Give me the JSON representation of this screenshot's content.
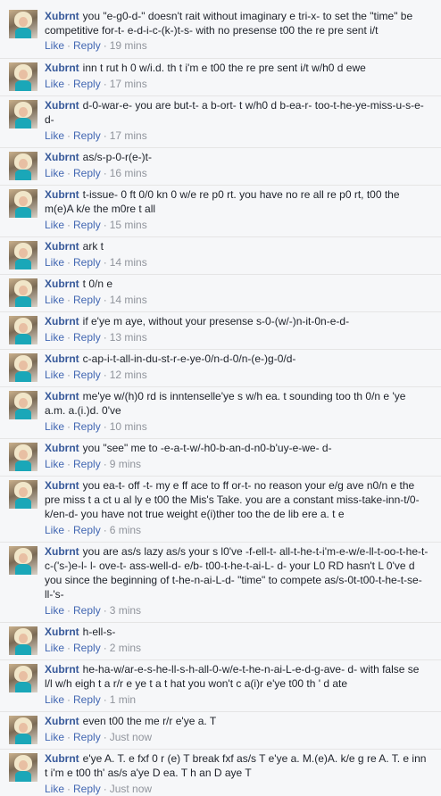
{
  "labels": {
    "like": "Like",
    "reply": "Reply",
    "sep": "·"
  },
  "comments": [
    {
      "author": "Xubrnt",
      "text": "you \"e-g0-d-\" doesn't rait without imaginary e tri-x- to set the \"time\" be competitive for-t- e-d-i-c-(k-)t-s- with no presense t00 the re pre sent i/t",
      "time": "19 mins"
    },
    {
      "author": "Xubrnt",
      "text": "inn t rut h 0 w/i.d. th t i'm e t00 the re pre sent i/t w/h0 d ewe",
      "time": "17 mins"
    },
    {
      "author": "Xubrnt",
      "text": "d-0-war-e- you are but-t- a b-ort- t w/h0 d b-ea-r- too-t-he-ye-miss-u-s-e-d-",
      "time": "17 mins"
    },
    {
      "author": "Xubrnt",
      "text": "as/s-p-0-r(e-)t-",
      "time": "16 mins"
    },
    {
      "author": "Xubrnt",
      "text": "t-issue- 0 ft 0/0 kn 0 w/e re p0 rt. you have no re all re p0 rt, t00 the m(e)A k/e the m0re t all",
      "time": "15 mins"
    },
    {
      "author": "Xubrnt",
      "text": "ark t",
      "time": "14 mins"
    },
    {
      "author": "Xubrnt",
      "text": "t 0/n e",
      "time": "14 mins"
    },
    {
      "author": "Xubrnt",
      "text": "if e'ye m aye, without your presense s-0-(w/-)n-it-0n-e-d-",
      "time": "13 mins"
    },
    {
      "author": "Xubrnt",
      "text": "c-ap-i-t-all-in-du-st-r-e-ye-0/n-d-0/n-(e-)g-0/d-",
      "time": "12 mins"
    },
    {
      "author": "Xubrnt",
      "text": "me'ye w/(h)0 rd is inntenselle'ye s w/h ea. t sounding too th 0/n e 'ye a.m. a.(i.)d. 0've",
      "time": "10 mins"
    },
    {
      "author": "Xubrnt",
      "text": "you \"see\" me to -e-a-t-w/-h0-b-an-d-n0-b'uy-e-we- d-",
      "time": "9 mins"
    },
    {
      "author": "Xubrnt",
      "text": "you ea-t- off -t- my e ff ace to ff or-t- no reason your e/g ave n0/n e the pre miss t a ct u al ly e t00 the Mis's Take. you are a constant miss-take-inn-t/0-k/en-d- you have not true weight e(i)ther too the de lib ere a. t e",
      "time": "6 mins"
    },
    {
      "author": "Xubrnt",
      "text": "you are as/s lazy as/s your s l0've -f-ell-t- all-t-he-t-i'm-e-w/e-ll-t-oo-t-he-t-c-('s-)e-l- l- ove-t- ass-well-d- e/b- t00-t-he-t-ai-L- d- your L0 RD hasn't L 0've d you since the beginning of t-he-n-ai-L-d- \"time\" to compete as/s-0t-t00-t-he-t-se-ll-'s-",
      "time": "3 mins"
    },
    {
      "author": "Xubrnt",
      "text": "h-ell-s-",
      "time": "2 mins"
    },
    {
      "author": "Xubrnt",
      "text": "he-ha-w/ar-e-s-he-ll-s-h-all-0-w/e-t-he-n-ai-L-e-d-g-ave- d- with false se l/l w/h eigh t a r/r e ye t a t hat you won't c a(i)r e'ye t00 th ' d ate",
      "time": "1 min"
    },
    {
      "author": "Xubrnt",
      "text": "even t00 the me r/r e'ye a. T",
      "time": "Just now"
    },
    {
      "author": "Xubrnt",
      "text": "e'ye A. T. e fxf 0 r (e) T break fxf as/s T e'ye a. M.(e)A. k/e g re A. T. e inn t i'm e t00 th' as/s a'ye D ea. T h an D aye T",
      "time": "Just now"
    }
  ]
}
